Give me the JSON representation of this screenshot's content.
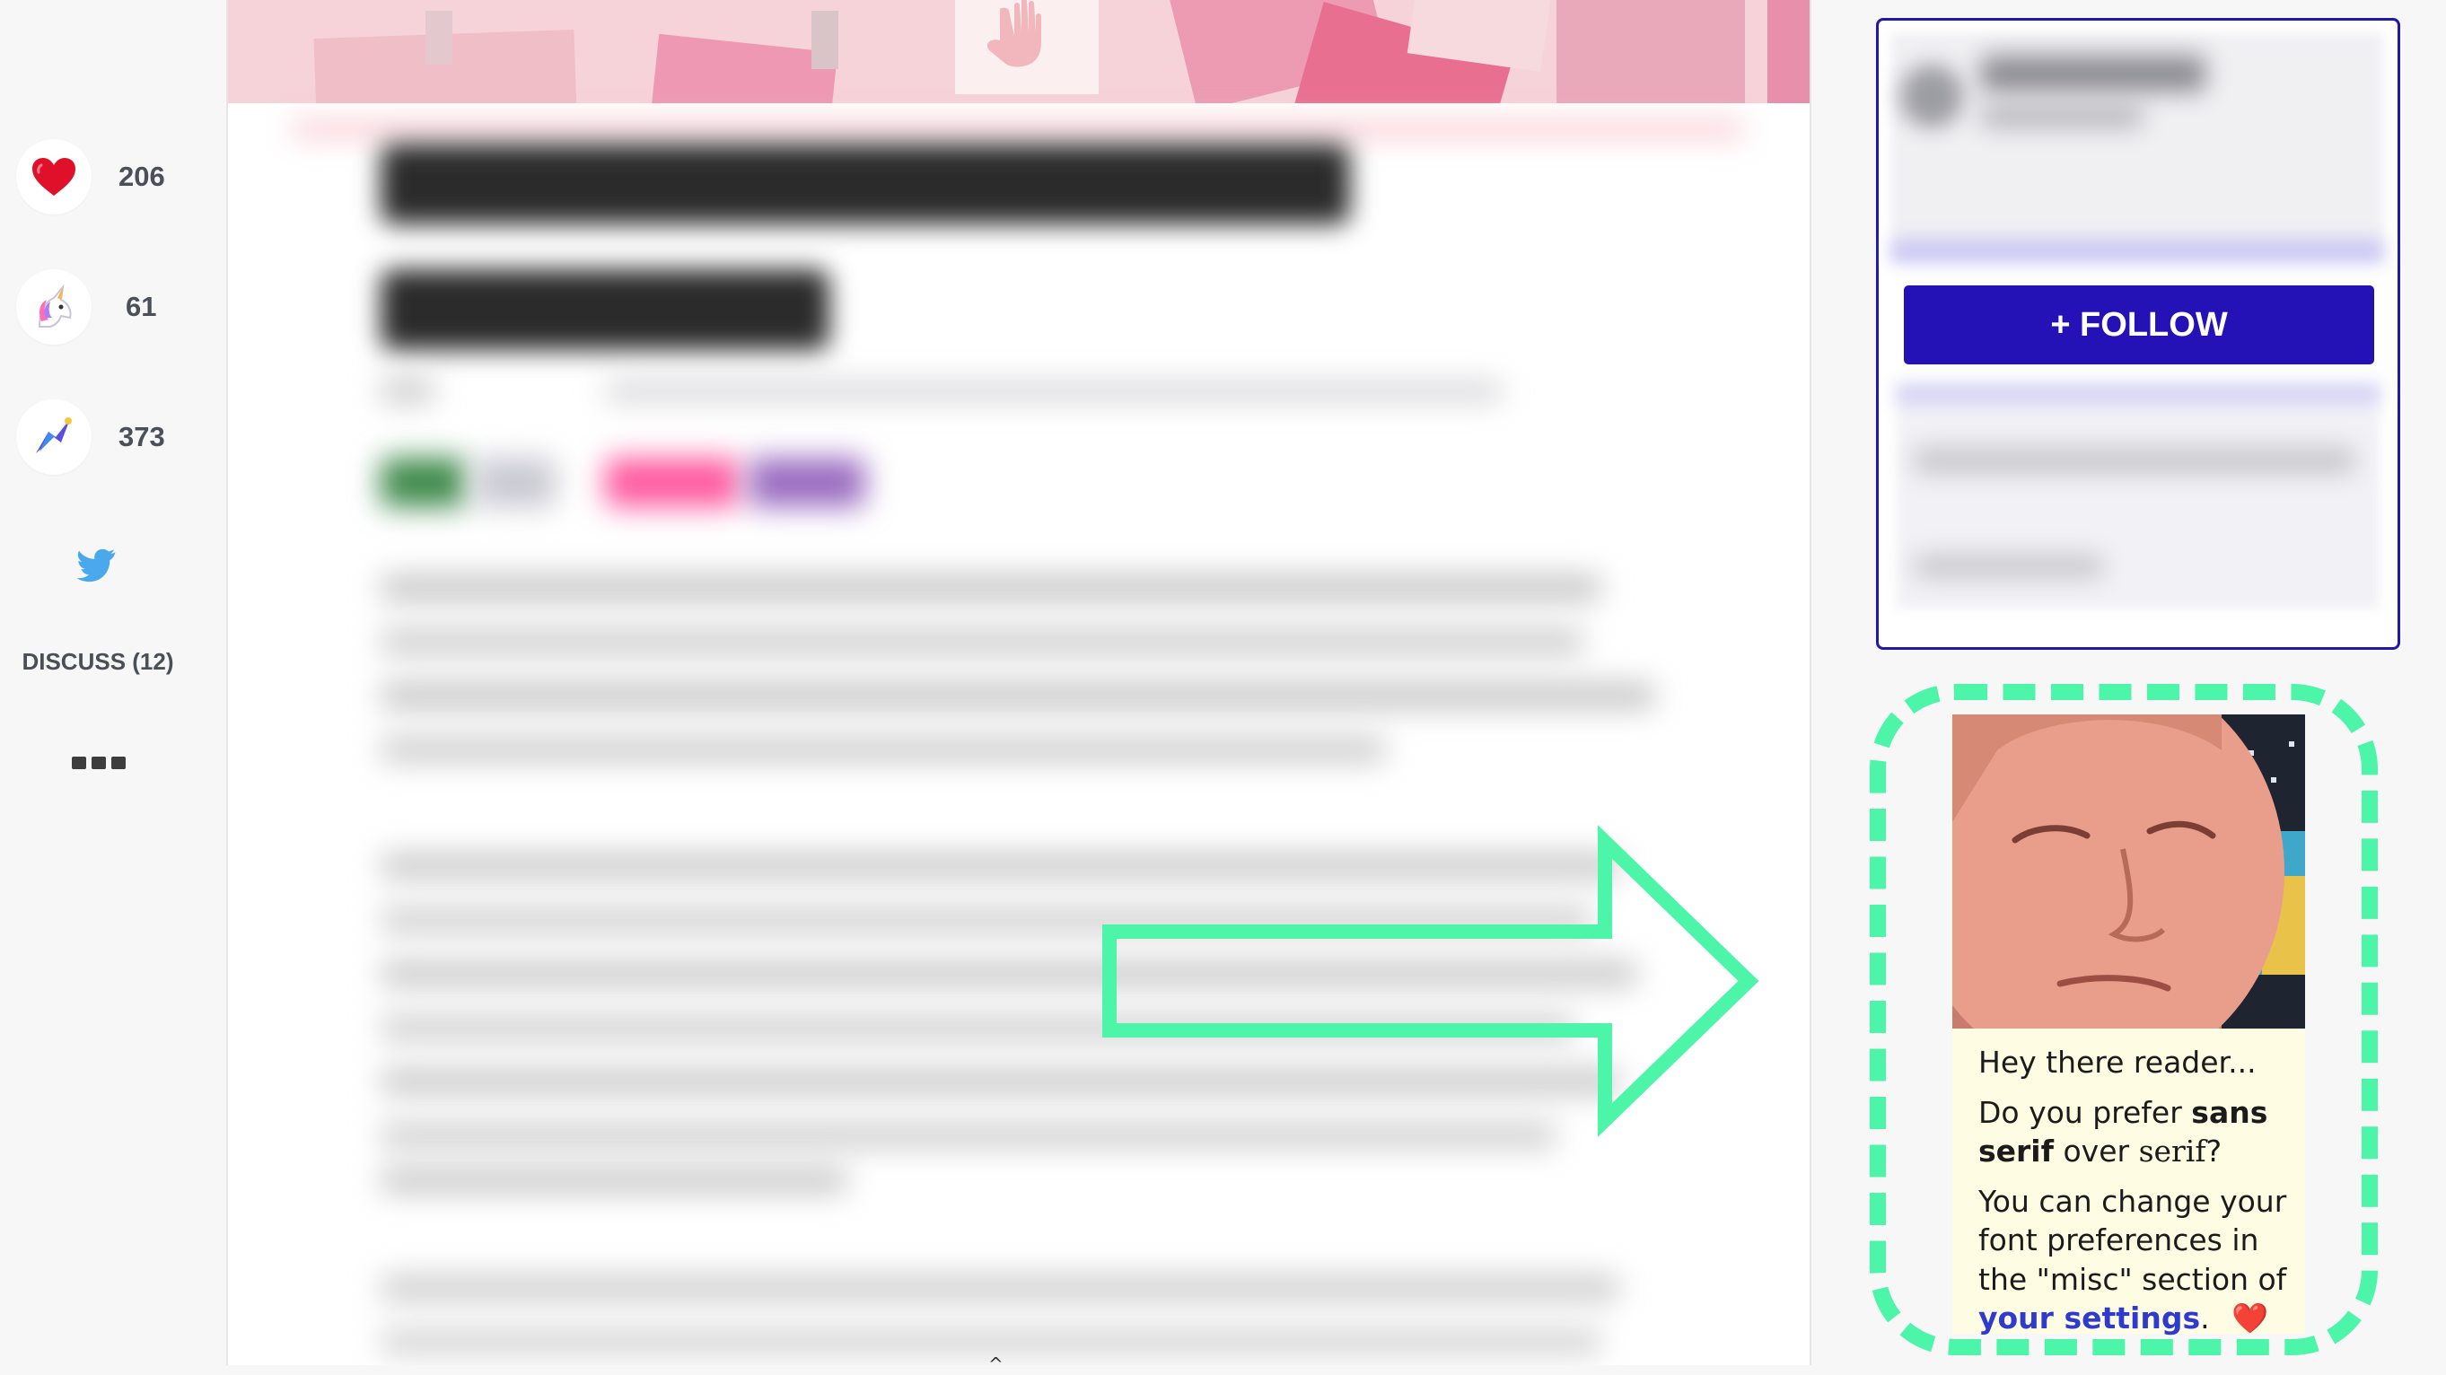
{
  "reactions": [
    {
      "name": "heart",
      "count": "206"
    },
    {
      "name": "unicorn",
      "count": "61"
    },
    {
      "name": "reading-list",
      "count": "373"
    }
  ],
  "discuss_label": "DISCUSS (12)",
  "profile": {
    "follow_label": "+ FOLLOW"
  },
  "promo": {
    "greeting": "Hey there reader...",
    "q_prefix": "Do you prefer",
    "q_bold": "sans serif",
    "q_mid": "over",
    "q_serif": "serif",
    "q_end": "?",
    "change_text": "You can change your font preferences in the \"misc\" section of",
    "settings_link": "your settings",
    "settings_suffix": ".",
    "heart_glyph": "❤️"
  },
  "colors": {
    "accent_green": "#4cf5a8",
    "follow_button": "#2412b6",
    "link": "#2f3bcf",
    "promo_background": "#fefde3"
  },
  "icons": [
    "heart-icon",
    "unicorn-icon",
    "bookmark-icon",
    "twitter-icon",
    "ellipsis-icon",
    "arrow-right-icon"
  ]
}
